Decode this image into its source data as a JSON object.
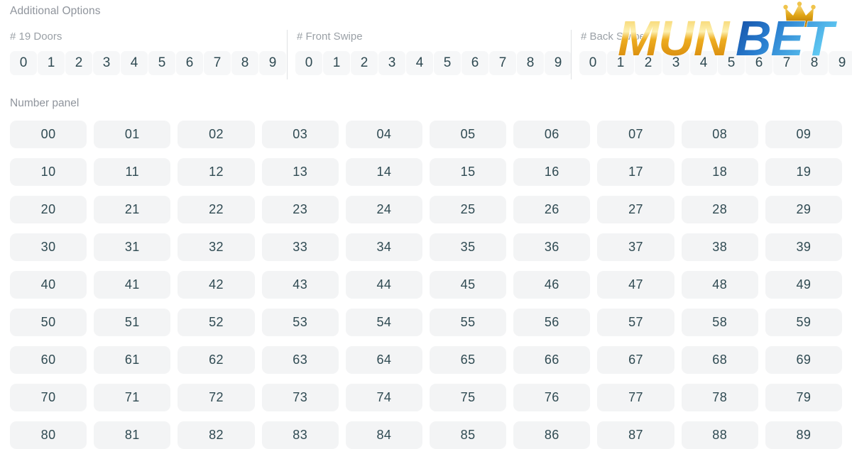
{
  "header": {
    "section_title": "Additional Options",
    "groups": [
      {
        "label": "# 19 Doors",
        "digits": [
          "0",
          "1",
          "2",
          "3",
          "4",
          "5",
          "6",
          "7",
          "8",
          "9"
        ]
      },
      {
        "label": "# Front Swipe",
        "digits": [
          "0",
          "1",
          "2",
          "3",
          "4",
          "5",
          "6",
          "7",
          "8",
          "9"
        ]
      },
      {
        "label": "# Back Swipe",
        "digits": [
          "0",
          "1",
          "2",
          "3",
          "4",
          "5",
          "6",
          "7",
          "8",
          "9"
        ]
      }
    ]
  },
  "panel": {
    "title": "Number panel",
    "columns": 10,
    "numbers": [
      "00",
      "01",
      "02",
      "03",
      "04",
      "05",
      "06",
      "07",
      "08",
      "09",
      "10",
      "11",
      "12",
      "13",
      "14",
      "15",
      "16",
      "17",
      "18",
      "19",
      "20",
      "21",
      "22",
      "23",
      "24",
      "25",
      "26",
      "27",
      "28",
      "29",
      "30",
      "31",
      "32",
      "33",
      "34",
      "35",
      "36",
      "37",
      "38",
      "39",
      "40",
      "41",
      "42",
      "43",
      "44",
      "45",
      "46",
      "47",
      "48",
      "49",
      "50",
      "51",
      "52",
      "53",
      "54",
      "55",
      "56",
      "57",
      "58",
      "59",
      "60",
      "61",
      "62",
      "63",
      "64",
      "65",
      "66",
      "67",
      "68",
      "69",
      "70",
      "71",
      "72",
      "73",
      "74",
      "75",
      "76",
      "77",
      "78",
      "79",
      "80",
      "81",
      "82",
      "83",
      "84",
      "85",
      "86",
      "87",
      "88",
      "89"
    ]
  },
  "logo": {
    "text_gold": "MUN",
    "text_blue": "BET",
    "crown_icon": "crown-icon",
    "gold_light": "#f7d264",
    "gold_dark": "#d98b10",
    "blue_dark": "#1b4fa8",
    "blue_light": "#56c3f0"
  },
  "colors": {
    "cell_bg": "#f3f4f5",
    "cell_text": "#2f4a52",
    "label_text": "#9aa0a6",
    "divider": "#dfe1e4",
    "page_bg": "#ffffff"
  }
}
